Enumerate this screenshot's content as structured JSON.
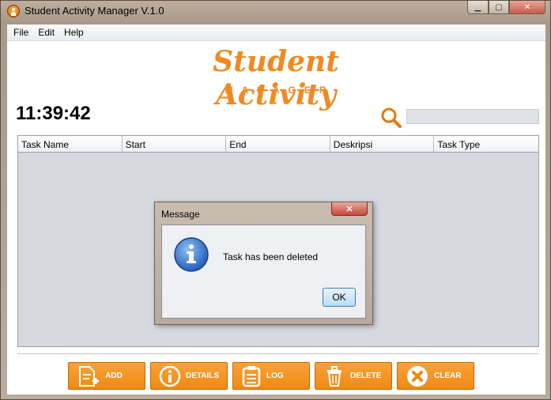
{
  "window": {
    "title": "Student Activity Manager V.1.0"
  },
  "menu": [
    "File",
    "Edit",
    "Help"
  ],
  "logo": {
    "main": "Student Activity",
    "sub": "MANAGER"
  },
  "clock": "11:39:42",
  "search": {
    "value": ""
  },
  "table": {
    "columns": [
      "Task Name",
      "Start",
      "End",
      "Deskripsi",
      "Task Type"
    ],
    "rows": []
  },
  "buttons": {
    "add": "ADD",
    "details": "DETAILS",
    "log": "LOG",
    "delete": "DELETE",
    "clear": "CLEAR"
  },
  "dialog": {
    "title": "Message",
    "message": "Task has been deleted",
    "ok": "OK"
  },
  "colors": {
    "accent": "#f08a20",
    "table_bg": "#d6d9e0"
  },
  "icons": {
    "app": "app-icon",
    "search": "search-icon",
    "info": "info-icon"
  }
}
